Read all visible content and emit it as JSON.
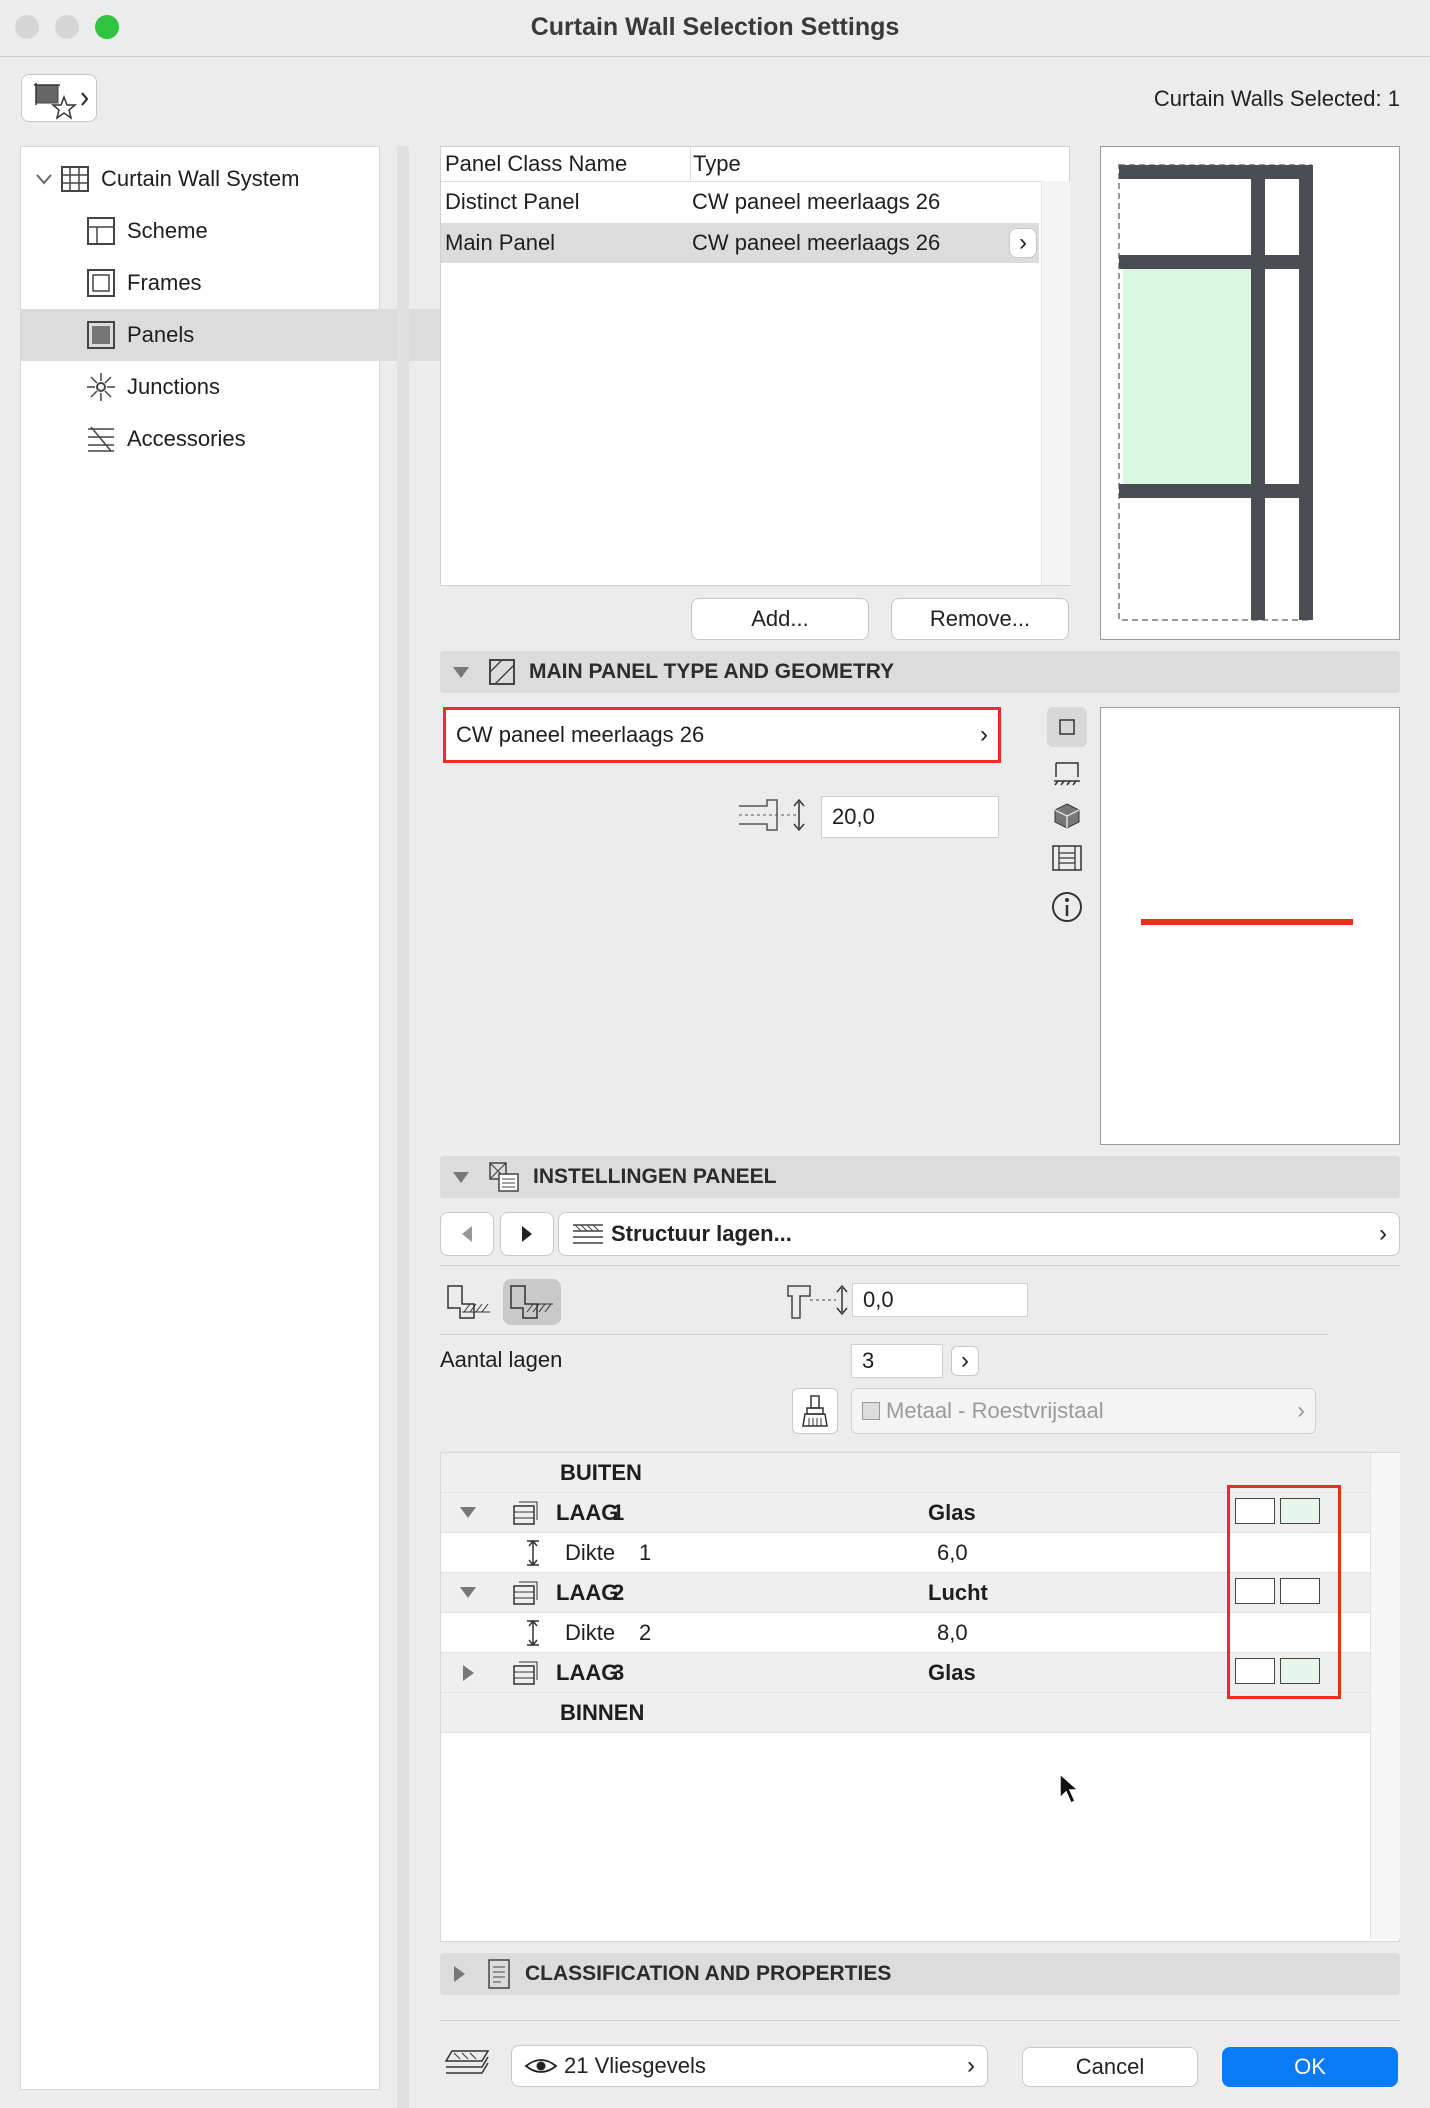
{
  "window": {
    "title": "Curtain Wall Selection Settings",
    "selected_label": "Curtain Walls Selected: 1"
  },
  "sidebar": {
    "root": "Curtain Wall System",
    "items": [
      {
        "label": "Scheme",
        "icon": "scheme-icon"
      },
      {
        "label": "Frames",
        "icon": "frames-icon"
      },
      {
        "label": "Panels",
        "icon": "panels-icon"
      },
      {
        "label": "Junctions",
        "icon": "junctions-icon"
      },
      {
        "label": "Accessories",
        "icon": "accessories-icon"
      }
    ],
    "selected": "Panels"
  },
  "panel_table": {
    "headers": [
      "Panel Class Name",
      "Type"
    ],
    "rows": [
      {
        "name": "Distinct Panel",
        "type": "CW paneel meerlaags 26"
      },
      {
        "name": "Main Panel",
        "type": "CW paneel meerlaags 26"
      }
    ],
    "add": "Add...",
    "remove": "Remove..."
  },
  "main_panel": {
    "header": "MAIN PANEL TYPE AND GEOMETRY",
    "type_value": "CW paneel meerlaags 26",
    "thickness": "20,0"
  },
  "instellingen": {
    "header": "INSTELLINGEN PANEEL",
    "structure": "Structuur lagen...",
    "offset": "0,0",
    "aantal_label": "Aantal lagen",
    "aantal_value": "3",
    "material": "Metaal - Roestvrijstaal"
  },
  "layers": {
    "outside": "BUITEN",
    "inside": "BINNEN",
    "rows": [
      {
        "kind": "laag",
        "label": "LAAG",
        "num": "1",
        "value": "Glas"
      },
      {
        "kind": "dikte",
        "label": "Dikte",
        "num": "1",
        "value": "6,0"
      },
      {
        "kind": "laag",
        "label": "LAAG",
        "num": "2",
        "value": "Lucht"
      },
      {
        "kind": "dikte",
        "label": "Dikte",
        "num": "2",
        "value": "8,0"
      },
      {
        "kind": "laag",
        "label": "LAAG",
        "num": "3",
        "value": "Glas"
      }
    ]
  },
  "classification": {
    "header": "CLASSIFICATION AND PROPERTIES"
  },
  "footer": {
    "layer": "21 Vliesgevels",
    "cancel": "Cancel",
    "ok": "OK"
  },
  "colors": {
    "accent": "#0a7bf7",
    "highlight": "#e8301c",
    "panel_fill": "#d9f7e3",
    "frame": "#4a4d52"
  }
}
